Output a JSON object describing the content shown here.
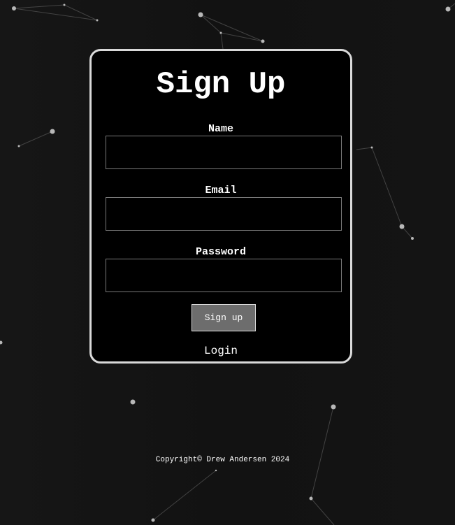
{
  "form": {
    "title": "Sign Up",
    "fields": [
      {
        "label": "Name",
        "value": "",
        "placeholder": ""
      },
      {
        "label": "Email",
        "value": "",
        "placeholder": ""
      },
      {
        "label": "Password",
        "value": "",
        "placeholder": ""
      }
    ],
    "submit_label": "Sign up",
    "login_link": "Login"
  },
  "footer": {
    "copyright": "Copyright© Drew Andersen 2024"
  },
  "colors": {
    "background": "#141414",
    "card": "#000000",
    "card_border": "#d9d9d9",
    "button": "#6d6d6d",
    "text": "#ffffff"
  }
}
